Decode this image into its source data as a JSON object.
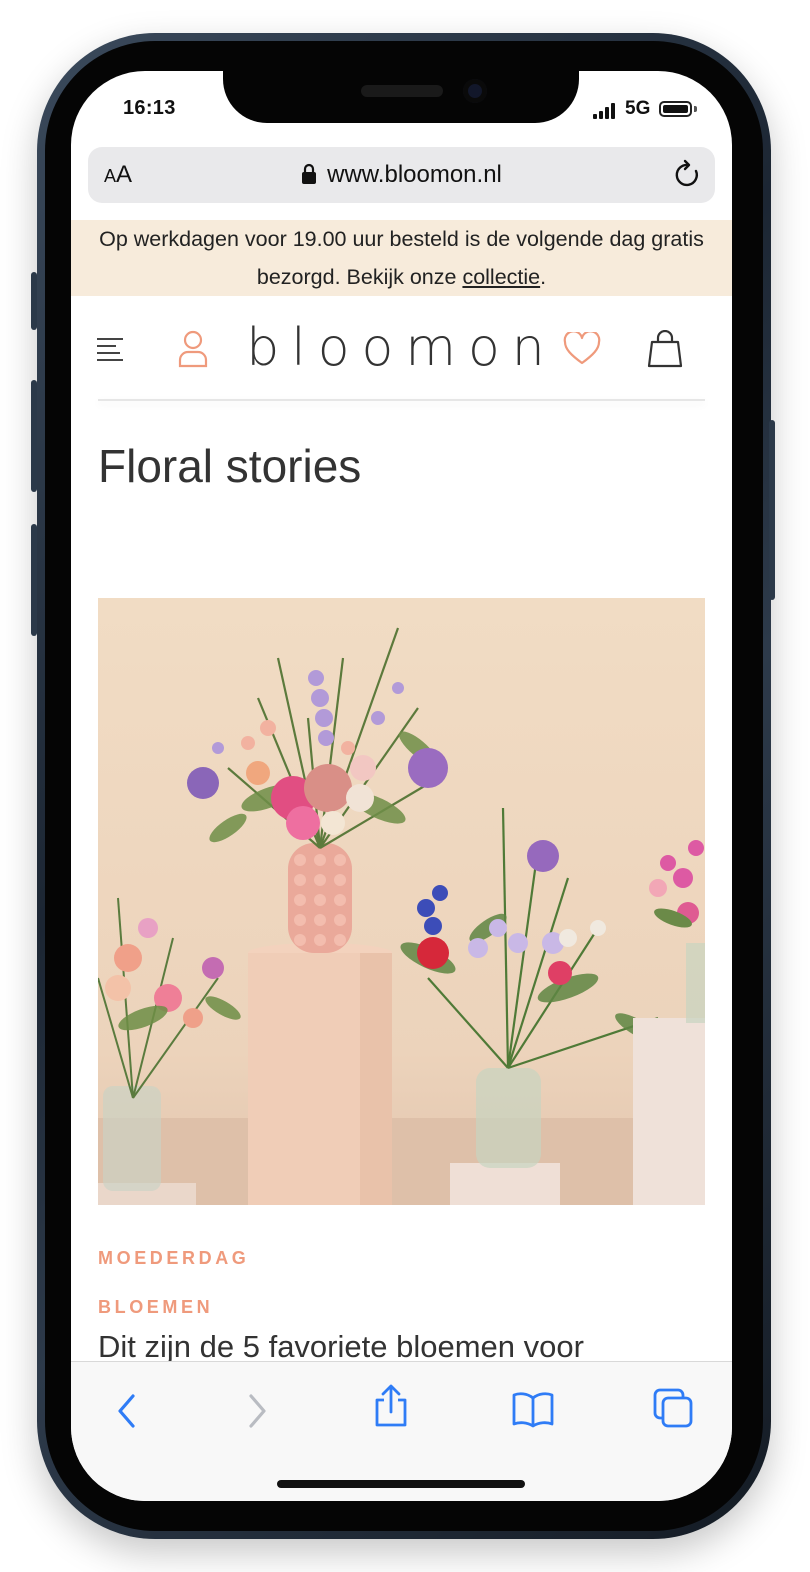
{
  "status_bar": {
    "time": "16:13",
    "network": "5G"
  },
  "browser": {
    "text_size_label_small": "A",
    "text_size_label_large": "A",
    "url": "www.bloomon.nl"
  },
  "banner": {
    "text": "Op werkdagen voor 19.00 uur besteld is de volgende dag gratis bezorgd. Bekijk onze ",
    "link": "collectie",
    "end": "."
  },
  "header": {
    "logo": "bloomon"
  },
  "page": {
    "title": "Floral stories"
  },
  "article": {
    "tags": [
      "MOEDERDAG",
      "BLOEMEN"
    ],
    "title": "Dit zijn de 5 favoriete bloemen voor"
  },
  "colors": {
    "accent": "#ef9a7c",
    "banner_bg": "#f7ebdb",
    "ios_blue": "#2f7cf6"
  },
  "icons": [
    "menu-icon",
    "user-icon",
    "heart-icon",
    "bag-icon",
    "lock-icon",
    "reload-icon",
    "back-icon",
    "forward-icon",
    "share-icon",
    "bookmarks-icon",
    "tabs-icon"
  ]
}
